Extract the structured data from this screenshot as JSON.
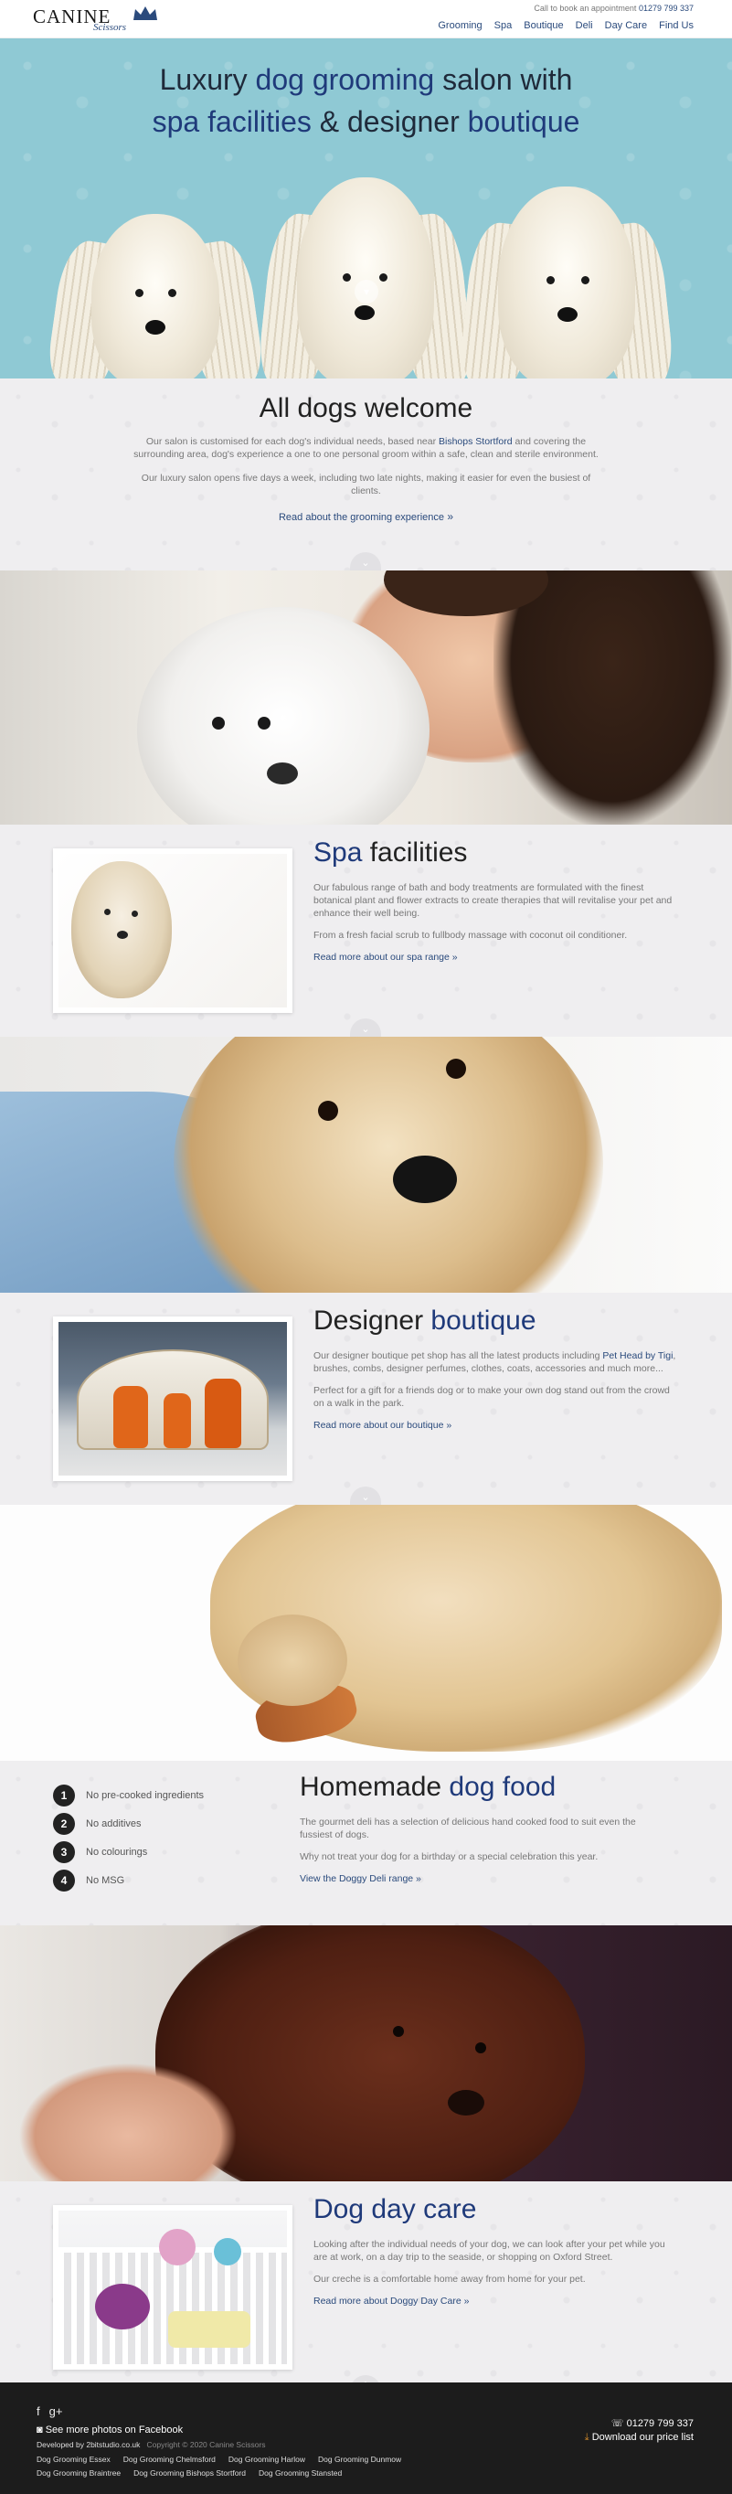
{
  "header": {
    "logo_main": "CANINE",
    "logo_script": "Scissors",
    "call_text": "Call to book an appointment",
    "phone": "01279 799 337",
    "nav": [
      "Grooming",
      "Spa",
      "Boutique",
      "Deli",
      "Day Care",
      "Find Us"
    ]
  },
  "hero": {
    "line1_a": "Luxury ",
    "line1_hl": "dog grooming",
    "line1_b": " salon with",
    "line2_hl1": "spa facilities",
    "line2_b": " & designer ",
    "line2_hl2": "boutique"
  },
  "welcome": {
    "title": "All dogs welcome",
    "p1_a": "Our salon is customised for each dog's individual needs, based near ",
    "p1_link": "Bishops Stortford",
    "p1_b": " and covering the surrounding area, dog's experience a one to one personal groom within a safe, clean and sterile environment.",
    "p2": "Our luxury salon opens five days a week, including two late nights, making it easier for even the busiest of clients.",
    "more": "Read about the grooming experience"
  },
  "spa": {
    "title_hl": "Spa",
    "title_rest": " facilities",
    "p1": "Our fabulous range of bath and body treatments are formulated with the finest botanical plant and flower extracts to create therapies that will revitalise your pet and enhance their well being.",
    "p2": "From a fresh facial scrub to fullbody massage with coconut oil conditioner.",
    "more": "Read more about our spa range"
  },
  "boutique": {
    "title_a": "Designer ",
    "title_hl": "boutique",
    "p1_a": "Our designer boutique pet shop has all the latest products including ",
    "p1_link": "Pet Head by Tigi",
    "p1_b": ", brushes, combs, designer perfumes, clothes, coats, accessories and much more...",
    "p2": "Perfect for a gift for a friends dog or to make your own dog stand out from the crowd on a walk in the park.",
    "more": "Read more about our boutique"
  },
  "food": {
    "list": [
      {
        "n": "1",
        "text": "No pre-cooked ingredients"
      },
      {
        "n": "2",
        "text": "No additives"
      },
      {
        "n": "3",
        "text": "No colourings"
      },
      {
        "n": "4",
        "text": "No MSG"
      }
    ],
    "title_a": "Homemade ",
    "title_hl": "dog food",
    "p1": "The gourmet deli has a selection of delicious hand cooked food to suit even the fussiest of dogs.",
    "p2": "Why not treat your dog for a birthday or a special celebration this year.",
    "more": "View the Doggy Deli range"
  },
  "daycare": {
    "title_hl": "Dog day care",
    "p1": "Looking after the individual needs of your dog, we can look after your pet while you are at work, on a day trip to the seaside, or shopping on Oxford Street.",
    "p2": "Our creche is a comfortable home away from home for your pet.",
    "more": "Read more about Doggy Day Care"
  },
  "footer": {
    "see_more": "See more photos on Facebook",
    "developed": "Developed by 2bitstudio.co.uk",
    "copyright": "Copyright © 2020 Canine Scissors",
    "links": [
      "Dog Grooming Essex",
      "Dog Grooming Chelmsford",
      "Dog Grooming Harlow",
      "Dog Grooming Dunmow",
      "Dog Grooming Braintree",
      "Dog Grooming Bishops Stortford",
      "Dog Grooming Stansted"
    ],
    "phone": "01279 799 337",
    "price_list": "Download our price list"
  },
  "colors": {
    "accent": "#2a4a7c",
    "hero_bg": "#8fc9d4",
    "footer_bg": "#1c1c1c"
  }
}
